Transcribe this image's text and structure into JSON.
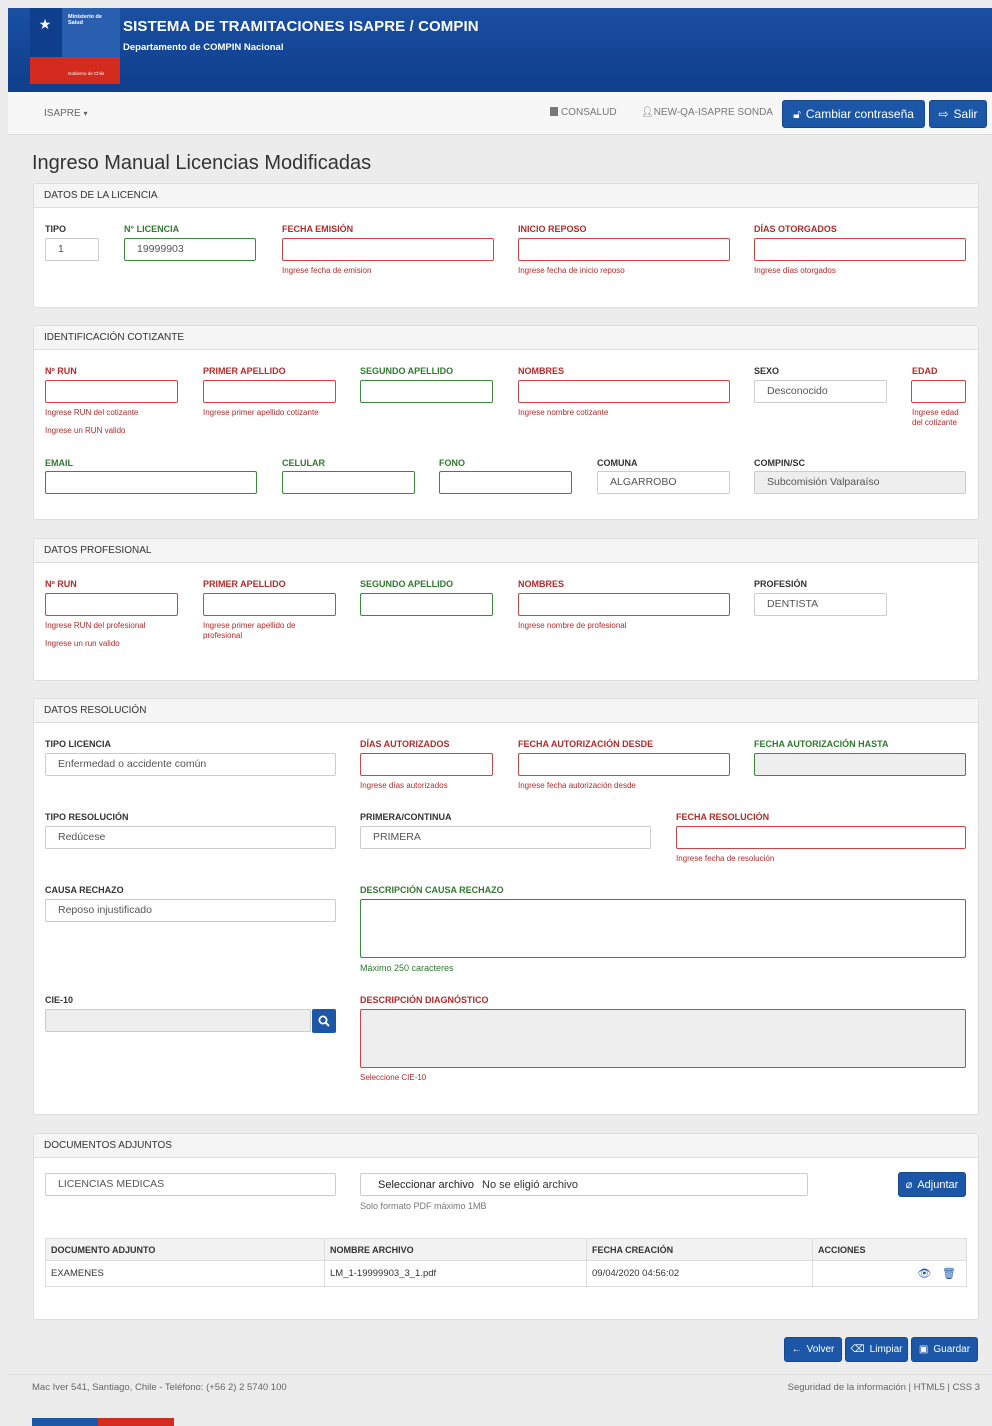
{
  "header": {
    "logo_ministry": "Ministerio de Salud",
    "logo_gob": "Gobierno de Chile",
    "title": "SISTEMA DE TRAMITACIONES ISAPRE / COMPIN",
    "subtitle": "Departamento de COMPIN Nacional"
  },
  "nav": {
    "isapre": "ISAPRE",
    "consalud": "CONSALUD",
    "user": "NEW-QA-ISAPRE SONDA",
    "change_password": "Cambiar contraseña",
    "logout": "Salir"
  },
  "page_title": "Ingreso Manual Licencias Modificadas",
  "licencia": {
    "heading": "DATOS DE LA LICENCIA",
    "tipo_label": "TIPO",
    "tipo_value": "1",
    "numero_label": "N° LICENCIA",
    "numero_value": "19999903",
    "fecha_emision_label": "FECHA EMISIÓN",
    "fecha_emision_help": "Ingrese fecha de emision",
    "inicio_reposo_label": "INICIO REPOSO",
    "inicio_reposo_help": "Ingrese fecha de inicio reposo",
    "dias_otorgados_label": "DÍAS OTORGADOS",
    "dias_otorgados_help": "Ingrese días otorgados"
  },
  "cotizante": {
    "heading": "IDENTIFICACIÓN COTIZANTE",
    "run_label": "Nº RUN",
    "run_help1": "Ingrese RUN del cotizante",
    "run_help2": "Ingrese un RUN valido",
    "primer_apellido_label": "PRIMER APELLIDO",
    "primer_apellido_help": "Ingrese primer apellido cotizante",
    "segundo_apellido_label": "SEGUNDO APELLIDO",
    "nombres_label": "NOMBRES",
    "nombres_help": "Ingrese nombre cotizante",
    "sexo_label": "SEXO",
    "sexo_value": "Desconocido",
    "edad_label": "EDAD",
    "edad_help": "Ingrese edad del cotizante",
    "email_label": "EMAIL",
    "celular_label": "CELULAR",
    "fono_label": "FONO",
    "comuna_label": "COMUNA",
    "comuna_value": "ALGARROBO",
    "compin_label": "COMPIN/SC",
    "compin_value": "Subcomisión Valparaíso"
  },
  "profesional": {
    "heading": "DATOS PROFESIONAL",
    "run_label": "Nº RUN",
    "run_help1": "Ingrese RUN del profesional",
    "run_help2": "Ingrese un run valido",
    "primer_apellido_label": "PRIMER APELLIDO",
    "primer_apellido_help": "Ingrese primer apellido de profesional",
    "segundo_apellido_label": "SEGUNDO APELLIDO",
    "nombres_label": "NOMBRES",
    "nombres_help": "Ingrese nombre de profesional",
    "profesion_label": "PROFESIÓN",
    "profesion_value": "DENTISTA"
  },
  "resolucion": {
    "heading": "DATOS RESOLUCIÓN",
    "tipo_licencia_label": "TIPO LICENCIA",
    "tipo_licencia_value": "Enfermedad o accidente común",
    "dias_autorizados_label": "DÍAS AUTORIZADOS",
    "dias_autorizados_help": "Ingrese días autorizados",
    "fecha_desde_label": "FECHA AUTORIZACIÓN DESDE",
    "fecha_desde_help": "Ingrese fecha autorización desde",
    "fecha_hasta_label": "FECHA AUTORIZACIÓN HASTA",
    "tipo_resolucion_label": "TIPO RESOLUCIÓN",
    "tipo_resolucion_value": "Redúcese",
    "primera_continua_label": "PRIMERA/CONTINUA",
    "primera_continua_value": "PRIMERA",
    "fecha_resolucion_label": "FECHA RESOLUCIÓN",
    "fecha_resolucion_help": "Ingrese fecha de resolución",
    "causa_rechazo_label": "CAUSA RECHAZO",
    "causa_rechazo_value": "Reposo injustificado",
    "descripcion_causa_label": "DESCRIPCIÓN CAUSA RECHAZO",
    "descripcion_causa_help": "Máximo 250 caracteres",
    "cie10_label": "CIE-10",
    "descripcion_diag_label": "DESCRIPCIÓN DIAGNÓSTICO",
    "descripcion_diag_help": "Seleccione CIE-10"
  },
  "documentos": {
    "heading": "DOCUMENTOS ADJUNTOS",
    "tipo_value": "LICENCIAS MEDICAS",
    "file_button": "Seleccionar archivo",
    "file_none": "No se eligió archivo",
    "file_help": "Solo formato PDF máximo 1MB",
    "attach_button": "Adjuntar",
    "columns": [
      "DOCUMENTO ADJUNTO",
      "NOMBRE ARCHIVO",
      "FECHA CREACIÓN",
      "ACCIONES"
    ],
    "rows": [
      {
        "documento": "EXAMENES",
        "archivo": "LM_1-19999903_3_1.pdf",
        "fecha": "09/04/2020 04:56:02"
      }
    ]
  },
  "actions": {
    "back": "Volver",
    "clear": "Limpiar",
    "save": "Guardar"
  },
  "footer": {
    "address": "Mac Iver 541, Santiago, Chile - Teléfono: (+56 2) 2 5740 100",
    "links": "Seguridad de la información | HTML5 | CSS 3"
  },
  "colors": {
    "primary": "#1b57a6",
    "header": "#0f3e8c",
    "error": "#b52a2a",
    "success": "#2f7a2f"
  }
}
